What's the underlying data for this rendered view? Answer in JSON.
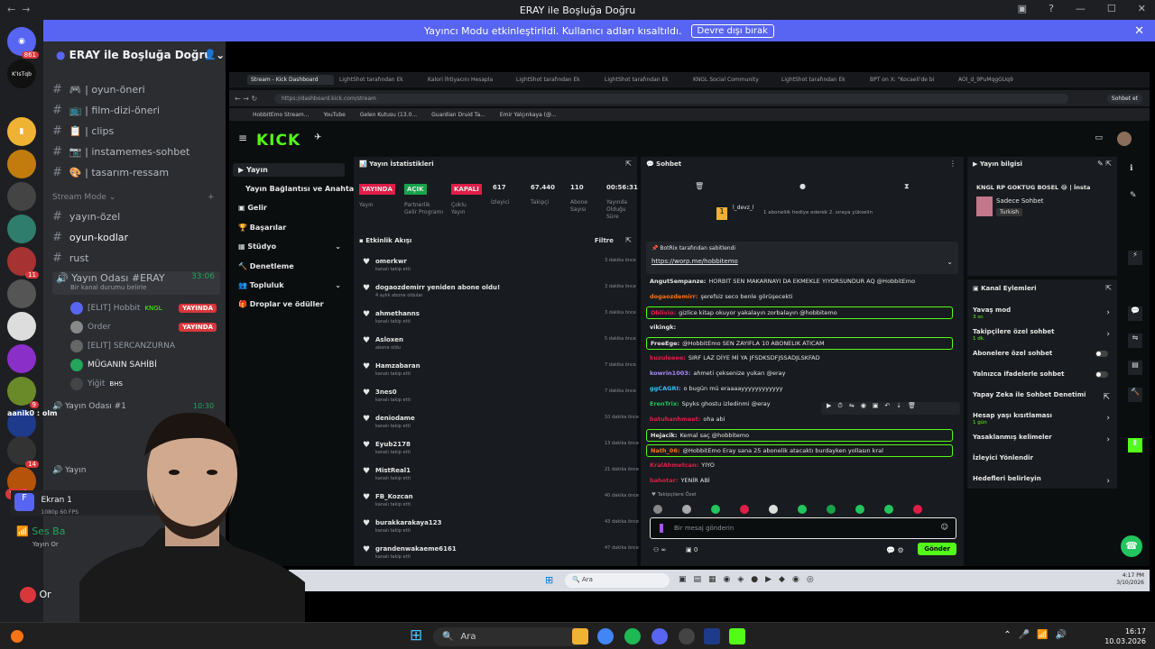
{
  "window": {
    "title": "ERAY ile Boşluğa Doğru"
  },
  "banner": {
    "text": "Yayıncı Modu etkinleştirildi. Kullanıcı adları kısaltıldı.",
    "button": "Devre dışı bırak"
  },
  "servers": {
    "badges": [
      "861",
      "11",
      "9",
      "14",
      "172"
    ],
    "new_label": "YENİ",
    "kick_label": "K'IsTqb"
  },
  "sidebar": {
    "guild": "ERAY ile Boşluğa Doğru",
    "channels": [
      {
        "name": "oyun-öneri",
        "icon": "🎮"
      },
      {
        "name": "film-dizi-öneri",
        "icon": "📺"
      },
      {
        "name": "clips",
        "icon": "📋"
      },
      {
        "name": "instamemes-sohbet",
        "icon": "📷"
      },
      {
        "name": "tasarım-ressam",
        "icon": "🎨"
      }
    ],
    "stream_mode": "Stream Mode",
    "channels2": [
      "yayın-özel",
      "oyun-kodlar",
      "rust"
    ],
    "voice": {
      "name": "Yayın Odası #ERAY",
      "time": "33:06",
      "status": "Bir kanal durumu belirle"
    },
    "voice_users": [
      {
        "name": "[ELIT] Hobbit",
        "tag": "KNGL",
        "live": "YAYINDA"
      },
      {
        "name": "Order",
        "live": "YAYINDA"
      },
      {
        "name": "[ELIT] SERCANZURNA"
      },
      {
        "name": "MÜGANIN SAHİBİ"
      },
      {
        "name": "Yiğit",
        "tag": "BHS"
      }
    ],
    "voice2": {
      "name": "Yayın Odası #1",
      "time": "10:30",
      "overlay": "aanik0 : olm"
    },
    "voice3": {
      "name": "Yayın",
      "time": "43"
    },
    "ekran": {
      "title": "Ekran 1",
      "sub": "1080p 60 FPS"
    },
    "ses": {
      "title": "Ses Ba",
      "sub": "Yayın Or"
    },
    "user": "Or"
  },
  "browser": {
    "tabs": [
      "Stream - Kick Dashboard",
      "LightShot tarafından Ek",
      "Kalori İhtiyacını Hesapla",
      "LightShot tarafından Ek",
      "LightShot tarafından Ek",
      "KNGL Social Community",
      "LightShot tarafından Ek",
      "BPT on X: \"Kocaeli'de bi",
      "AOl_d_9PuMqgGUq9"
    ],
    "url": "https://dashboard.kick.com/stream",
    "bookmarks": [
      "HobbitEmo Stream...",
      "YouTube",
      "Gelen Kutusu (13.0...",
      "Guardian Druid Ta...",
      "Emir Yalçınkaya (@..."
    ],
    "sohbet_btn": "Sohbet et"
  },
  "kick": {
    "logo": "KICK",
    "nav": [
      "Yayın",
      "Yayın Bağlantısı ve Anahtarı",
      "Gelir",
      "Başarılar",
      "Stüdyo",
      "Denetleme",
      "Topluluk",
      "Droplar ve ödüller"
    ],
    "stats": {
      "title": "Yayın İstatistikleri",
      "items": [
        {
          "value": "YAYINDA",
          "label": "Yayın",
          "pill": "#e11d48"
        },
        {
          "value": "AÇIK",
          "label": "Partnerlik Gelir Programı",
          "pill": "#16a34a"
        },
        {
          "value": "KAPALI",
          "label": "Çoklu Yayın",
          "pill": "#e11d48"
        },
        {
          "value": "617",
          "label": "İzleyici"
        },
        {
          "value": "67.440",
          "label": "Takipçi"
        },
        {
          "value": "110",
          "label": "Abone Sayısı"
        },
        {
          "value": "00:56:31",
          "label": "Yayında Olduğu Süre"
        }
      ]
    },
    "events": {
      "title": "Etkinlik Akışı",
      "filter": "Filtre",
      "items": [
        {
          "name": "omerkwr",
          "desc": "kanalı takip etti",
          "time": "3 dakika önce"
        },
        {
          "name": "dogaozdemirr yeniden abone oldu!",
          "desc": "4 aylık abone oldular",
          "time": "3 dakika önce"
        },
        {
          "name": "ahmethanns",
          "desc": "kanalı takip etti",
          "time": "3 dakika önce"
        },
        {
          "name": "Asloxen",
          "desc": "abone oldu",
          "time": "5 dakika önce"
        },
        {
          "name": "Hamzabaran",
          "desc": "kanalı takip etti",
          "time": "7 dakika önce"
        },
        {
          "name": "3nes0",
          "desc": "kanalı takip etti",
          "time": "7 dakika önce"
        },
        {
          "name": "deniodame",
          "desc": "kanalı takip etti",
          "time": "10 dakika önce"
        },
        {
          "name": "Eyub2178",
          "desc": "kanalı takip etti",
          "time": "13 dakika önce"
        },
        {
          "name": "MistReal1",
          "desc": "kanalı takip etti",
          "time": "21 dakika önce"
        },
        {
          "name": "FB_Kozcan",
          "desc": "kanalı takip etti",
          "time": "40 dakika önce"
        },
        {
          "name": "burakkarakaya123",
          "desc": "kanalı takip etti",
          "time": "43 dakika önce"
        },
        {
          "name": "grandenwakaeme6161",
          "desc": "kanalı takip etti",
          "time": "47 dakika önce"
        }
      ]
    },
    "chat": {
      "title": "Sohbet",
      "gifter": "l_devz_l",
      "gift_text": "1 aboneliik hediye ederek 2. sıraya yükselin",
      "pinned_by": "BotRix tarafından sabitlendi",
      "pinned_link": "https://worp.me/hobbitemo",
      "messages": [
        {
          "user": "AngutSempanze:",
          "text": "HORBIT SEN MAKARNAYI DA EKMEKLE YIYORSUNDUR AQ @HobbitEmo",
          "color": "#e6e6e6",
          "hl": false
        },
        {
          "user": "dogaozdemirr:",
          "text": "şerefsiz seco benle görüşecekti",
          "color": "#f97316",
          "hl": false
        },
        {
          "user": "Oblivio:",
          "text": "gizlice kitap okuyor yakalayın zorbalayın @hobbitemo",
          "color": "#e11d48",
          "hl": true
        },
        {
          "user": "vikingk:",
          "text": "",
          "color": "#e6e6e6",
          "hl": false
        },
        {
          "user": "FreeEge:",
          "text": "@HobbitEmo SEN ZAYIFLA 10 ABONELIK ATICAM",
          "color": "#e6e6e6",
          "hl": true
        },
        {
          "user": "kuzuleeee:",
          "text": "SIRF LAZ DİYE Mİ YA JFSDKSDFJSSADJLSKFAD",
          "color": "#e11d48",
          "hl": false
        },
        {
          "user": "kowrin1003:",
          "text": "ahmeti çeksenize yukarı @eray",
          "color": "#a78bfa",
          "hl": false
        },
        {
          "user": "ggCAGRI:",
          "text": "o bugün mü eraaaayyyyyyyyyyyy",
          "color": "#38bdf8",
          "hl": false
        },
        {
          "user": "ErenTrix:",
          "text": "Spyks ghostu izledinmi @eray",
          "color": "#22c55e",
          "hl": false
        },
        {
          "user": "batuhanhmeet:",
          "text": "oha abi",
          "color": "#e11d48",
          "hl": false
        },
        {
          "user": "Hejacik:",
          "text": "Kemal saç @hobbitemo",
          "color": "#e6e6e6",
          "hl": true
        },
        {
          "user": "Nath_06:",
          "text": "@HobbitEmo Eray sana 25 abonelik atacaktı burdayken yollasın kral",
          "color": "#f97316",
          "hl": true
        },
        {
          "user": "KralAhmetcan:",
          "text": "YIYO",
          "color": "#e11d48",
          "hl": false
        },
        {
          "user": "bahotar:",
          "text": "YENİR ABİ",
          "color": "#e11d48",
          "hl": false
        }
      ],
      "followers_label": "Takipçilere Özel",
      "input_placeholder": "Bir mesaj gönderin",
      "count_a": "0",
      "send": "Gönder"
    },
    "info": {
      "title": "Yayın bilgisi",
      "stream_title": "KNGL RP GOKTUG BOSEL 😂 | İnsta",
      "sub": "Sadece Sohbet",
      "lang": "Turkish"
    },
    "actions": {
      "title": "Kanal Eylemleri",
      "items": [
        {
          "label": "Yavaş mod",
          "sub": "3 sn",
          "type": "chev"
        },
        {
          "label": "Takipçilere özel sohbet",
          "sub": "1 dk.",
          "type": "chev"
        },
        {
          "label": "Abonelere özel sohbet",
          "sub": "",
          "type": "toggle"
        },
        {
          "label": "Yalnızca ifadelerle sohbet",
          "sub": "",
          "type": "toggle"
        },
        {
          "label": "Yapay Zeka ile Sohbet Denetimi",
          "sub": "",
          "type": "ext"
        },
        {
          "label": "Hesap yaşı kısıtlaması",
          "sub": "1 gün",
          "type": "chev"
        },
        {
          "label": "Yasaklanmış kelimeler",
          "sub": "",
          "type": "chev"
        },
        {
          "label": "İzleyici Yönlendir",
          "sub": "",
          "type": "none"
        },
        {
          "label": "Hedefleri belirleyin",
          "sub": "",
          "type": "chev"
        }
      ]
    },
    "inner_taskbar": {
      "search": "Ara",
      "time": "4:17 PM",
      "date": "3/10/2026"
    }
  },
  "taskbar": {
    "search": "Ara",
    "time": "16:17",
    "date": "10.03.2026"
  }
}
